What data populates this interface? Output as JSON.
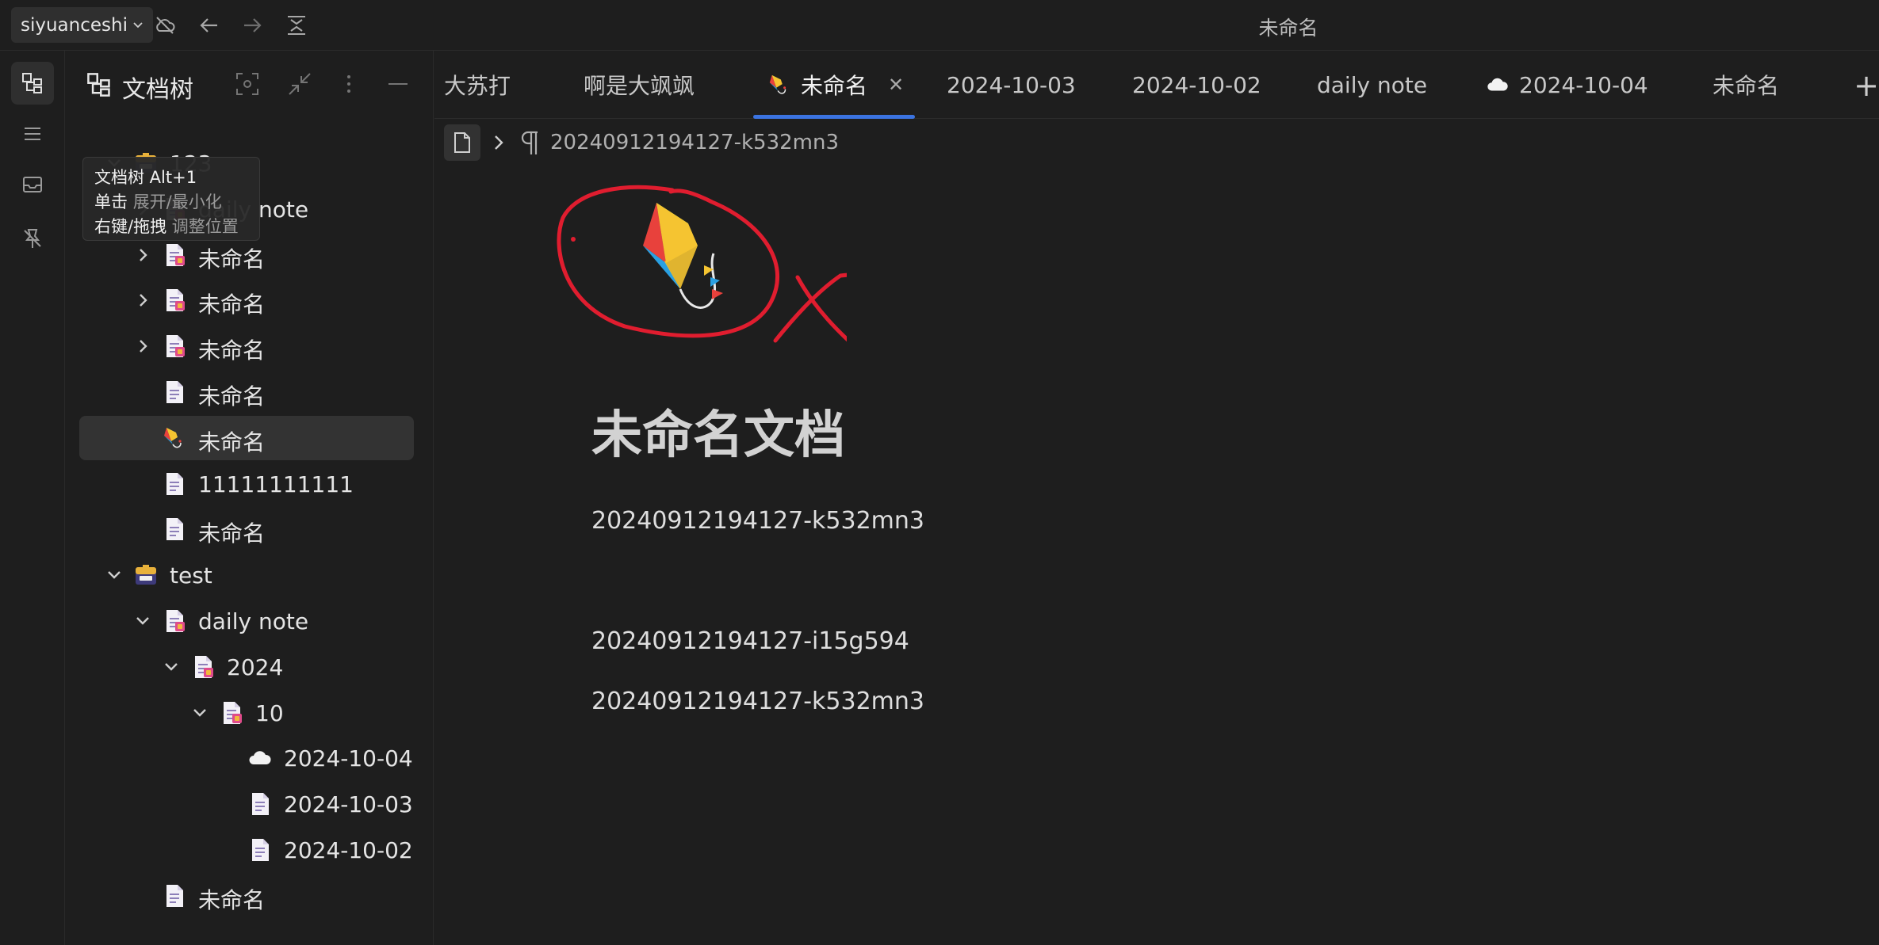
{
  "titlebar": {
    "workspace": "siyuanceshi",
    "window_title": "未命名"
  },
  "tree": {
    "title": "文档树",
    "rows": [
      {
        "label": "123",
        "depth": 0,
        "expanded": true,
        "icon": "notebook-icon"
      },
      {
        "label": "daily note",
        "depth": 1,
        "expanded": false,
        "icon": "doc-folder-icon"
      },
      {
        "label": "未命名",
        "depth": 1,
        "expanded": false,
        "icon": "doc-folder-icon"
      },
      {
        "label": "未命名",
        "depth": 1,
        "expanded": false,
        "icon": "doc-folder-icon"
      },
      {
        "label": "未命名",
        "depth": 1,
        "expanded": false,
        "icon": "doc-folder-icon"
      },
      {
        "label": "未命名",
        "depth": 1,
        "icon": "document-icon"
      },
      {
        "label": "未命名",
        "depth": 1,
        "icon": "kite-icon",
        "selected": true
      },
      {
        "label": "11111111111",
        "depth": 1,
        "icon": "document-icon"
      },
      {
        "label": "未命名",
        "depth": 1,
        "icon": "document-icon"
      },
      {
        "label": "test",
        "depth": 0,
        "expanded": true,
        "icon": "notebook-icon"
      },
      {
        "label": "daily note",
        "depth": 1,
        "expanded": true,
        "icon": "doc-folder-icon"
      },
      {
        "label": "2024",
        "depth": 2,
        "expanded": true,
        "icon": "doc-folder-icon"
      },
      {
        "label": "10",
        "depth": 3,
        "expanded": true,
        "icon": "doc-folder-icon"
      },
      {
        "label": "2024-10-04",
        "depth": 4,
        "icon": "cloud-icon"
      },
      {
        "label": "2024-10-03",
        "depth": 4,
        "icon": "document-icon"
      },
      {
        "label": "2024-10-02",
        "depth": 4,
        "icon": "document-icon"
      },
      {
        "label": "未命名",
        "depth": 1,
        "icon": "document-icon"
      }
    ]
  },
  "tooltip": {
    "line1": "文档树 Alt+1",
    "line2_key": "单击",
    "line2_val": "展开/最小化",
    "line3_key": "右键/拖拽",
    "line3_val": "调整位置"
  },
  "tabs": [
    {
      "label": "大苏打"
    },
    {
      "label": "啊是大飒飒"
    },
    {
      "label": "未命名",
      "active": true,
      "icon": "kite-icon"
    },
    {
      "label": "2024-10-03"
    },
    {
      "label": "2024-10-02"
    },
    {
      "label": "daily note"
    },
    {
      "label": "2024-10-04",
      "icon": "cloud-icon"
    },
    {
      "label": "未命名"
    }
  ],
  "tab_add": "+",
  "breadcrumb": {
    "block_id": "20240912194127-k532mn3"
  },
  "editor": {
    "title": "未命名文档",
    "paragraphs": [
      "20240912194127-k532mn3",
      "20240912194127-i15g594",
      "20240912194127-k532mn3"
    ]
  },
  "colors": {
    "accent": "#3b73e0",
    "annotation": "#e01d2f"
  }
}
